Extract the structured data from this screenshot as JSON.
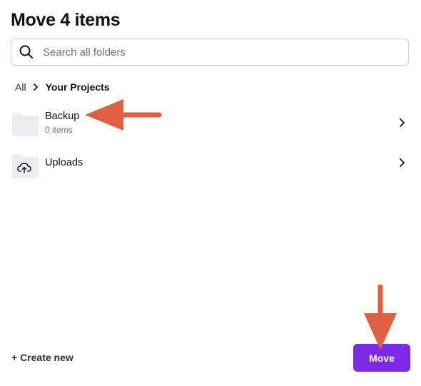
{
  "dialog": {
    "title": "Move 4 items"
  },
  "search": {
    "placeholder": "Search all folders",
    "value": "",
    "icon": "search-icon"
  },
  "breadcrumb": {
    "root": "All",
    "separator_icon": "chevron-right-icon",
    "current": "Your Projects"
  },
  "folders": [
    {
      "name": "Backup",
      "subtitle": "0 items",
      "icon": "folder-icon"
    },
    {
      "name": "Uploads",
      "subtitle": "",
      "icon": "cloud-upload-folder-icon"
    }
  ],
  "footer": {
    "create_new_label": "+ Create new",
    "move_label": "Move"
  },
  "colors": {
    "accent": "#7d2ae8",
    "annotation_arrow": "#e0603f",
    "folder_fill": "#ebeef1"
  }
}
